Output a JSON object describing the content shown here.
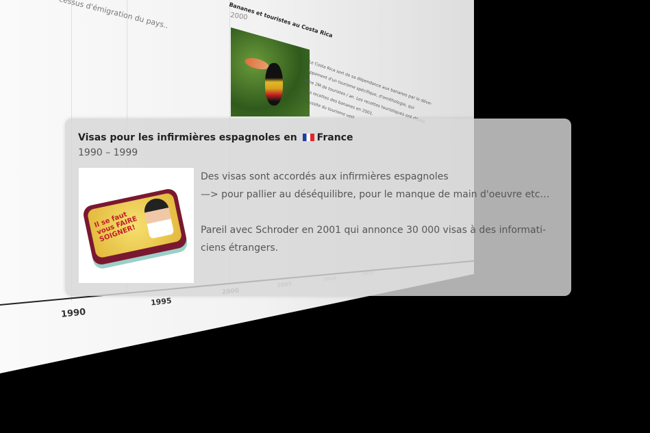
{
  "background_timeline": {
    "partial_event_text": "cessus d'émigration du pays..",
    "costa_rica_event": {
      "title": "Bananes et touristes au Costa Rica",
      "year": "2000",
      "text_lines": [
        "Le Costa Rica sort de sa dépendance aux bananes par le déve-",
        "loppement d'un tourisme spécifique, d'ornithologie, qui",
        "attire 2M de touristes / an. Les recettes touristiques ont dépas-",
        "sé les recettes des bananes en 2001.",
        "   --> réussite du tourisme vert"
      ]
    },
    "axis_ticks": [
      "1990",
      "1995",
      "2000",
      "2005",
      "2010",
      "2015"
    ]
  },
  "card": {
    "title": "Visas pour les infirmières espagnoles en",
    "country": "France",
    "flag_icon": "france-flag-icon",
    "dates": "1990 – 1999",
    "image_text": "Il se faut vous FAIRE SOIGNER!",
    "body_lines": [
      "Des visas sont accordés aux infirmières espagnoles",
      " —> pour pallier au déséquilibre, pour le manque de main d'oeuvre etc…",
      "",
      "Pareil avec Schroder en 2001 qui annonce 30 000 visas à des informati-",
      "ciens étrangers."
    ]
  }
}
